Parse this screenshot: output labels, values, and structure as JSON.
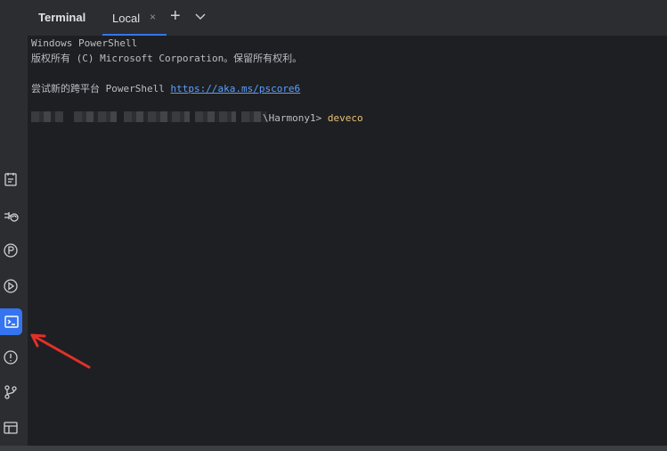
{
  "toolwindow": {
    "title": "Terminal"
  },
  "tabs": [
    {
      "label": "Local",
      "close": "×"
    }
  ],
  "tab_actions": {
    "add": "+",
    "more_icon": "chevron-down-icon"
  },
  "terminal": {
    "line1": "Windows PowerShell",
    "line2": "版权所有 (C) Microsoft Corporation。保留所有权利。",
    "line3_prefix": "尝试新的跨平台 PowerShell ",
    "line3_link": "https://aka.ms/pscore6",
    "prompt_suffix": "\\Harmony1> ",
    "command": "deveco"
  },
  "sidebar": {
    "items": [
      {
        "icon": "todo-icon",
        "active": false
      },
      {
        "icon": "services-icon",
        "active": false
      },
      {
        "icon": "profiler-icon",
        "active": false
      },
      {
        "icon": "run-icon",
        "active": false
      },
      {
        "icon": "terminal-icon",
        "active": true
      },
      {
        "icon": "problems-icon",
        "active": false
      },
      {
        "icon": "git-icon",
        "active": false
      },
      {
        "icon": "structure-icon",
        "active": false
      }
    ]
  },
  "colors": {
    "accent": "#3574f0",
    "link": "#5aa0ff",
    "command": "#e5c07b",
    "annotation_arrow": "#e0302a"
  }
}
